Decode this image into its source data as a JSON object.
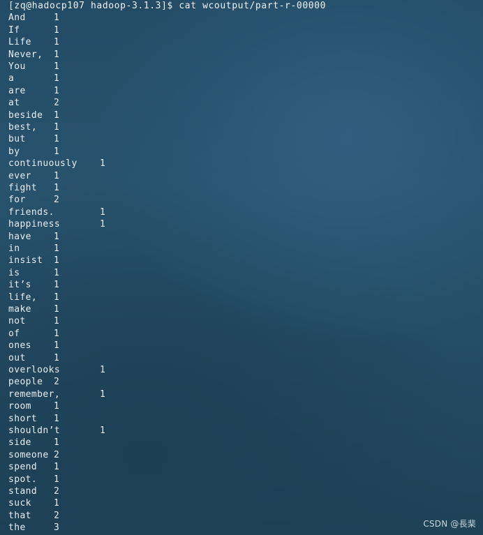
{
  "prompt": "[zq@hadocp107 hadoop-3.1.3]$ cat wcoutput/part-r-00000",
  "rows": [
    {
      "word": "And",
      "count": "1"
    },
    {
      "word": "If",
      "count": "1"
    },
    {
      "word": "Life",
      "count": "1"
    },
    {
      "word": "Never,",
      "count": "1"
    },
    {
      "word": "You",
      "count": "1"
    },
    {
      "word": "a",
      "count": "1"
    },
    {
      "word": "are",
      "count": "1"
    },
    {
      "word": "at",
      "count": "2"
    },
    {
      "word": "beside",
      "count": "1"
    },
    {
      "word": "best,",
      "count": "1"
    },
    {
      "word": "but",
      "count": "1"
    },
    {
      "word": "by",
      "count": "1"
    },
    {
      "word": "continuously",
      "count": "1"
    },
    {
      "word": "ever",
      "count": "1"
    },
    {
      "word": "fight",
      "count": "1"
    },
    {
      "word": "for",
      "count": "2"
    },
    {
      "word": "friends.",
      "count": "1"
    },
    {
      "word": "happiness",
      "count": "1"
    },
    {
      "word": "have",
      "count": "1"
    },
    {
      "word": "in",
      "count": "1"
    },
    {
      "word": "insist",
      "count": "1"
    },
    {
      "word": "is",
      "count": "1"
    },
    {
      "word": "it’s",
      "count": "1"
    },
    {
      "word": "life,",
      "count": "1"
    },
    {
      "word": "make",
      "count": "1"
    },
    {
      "word": "not",
      "count": "1"
    },
    {
      "word": "of",
      "count": "1"
    },
    {
      "word": "ones",
      "count": "1"
    },
    {
      "word": "out",
      "count": "1"
    },
    {
      "word": "overlooks",
      "count": "1"
    },
    {
      "word": "people",
      "count": "2"
    },
    {
      "word": "remember,",
      "count": "1"
    },
    {
      "word": "room",
      "count": "1"
    },
    {
      "word": "short",
      "count": "1"
    },
    {
      "word": "shouldn’t",
      "count": "1"
    },
    {
      "word": "side",
      "count": "1"
    },
    {
      "word": "someone",
      "count": "2"
    },
    {
      "word": "spend",
      "count": "1"
    },
    {
      "word": "spot.",
      "count": "1"
    },
    {
      "word": "stand",
      "count": "2"
    },
    {
      "word": "suck",
      "count": "1"
    },
    {
      "word": "that",
      "count": "2"
    },
    {
      "word": "the",
      "count": "3"
    }
  ],
  "watermark": "CSDN @長棐"
}
